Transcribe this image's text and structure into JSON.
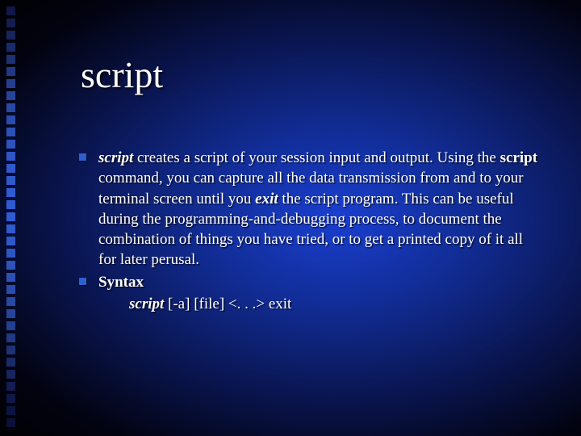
{
  "title": "script",
  "bullets": [
    {
      "cmd": "script",
      "t1": " creates a script of your session input and output. Using the ",
      "cmd2": "script",
      "t2": " command, you can capture all the data transmission from and to your terminal screen until you ",
      "exit": "exit",
      "t3": " the script program. This can be useful during the programming-and-debugging process, to document the combination of things you have tried, or to get a printed copy of it all for later perusal."
    },
    {
      "label": "Syntax",
      "cmd": "script",
      "args": " [-a] [file] <. . .> exit"
    }
  ],
  "deco_colors": [
    "#101848",
    "#141c50",
    "#18245c",
    "#1a2a68",
    "#1e3174",
    "#223882",
    "#253f90",
    "#27449a",
    "#2948a4",
    "#2b4cae",
    "#2d50b8",
    "#2e52be",
    "#2f55c4",
    "#3058ca",
    "#3059ce",
    "#305ad2",
    "#305ad4",
    "#305ad2",
    "#3059ce",
    "#3058ca",
    "#2f55c4",
    "#2e52be",
    "#2d50b8",
    "#2b4cae",
    "#2948a4",
    "#27449a",
    "#253f90",
    "#223882",
    "#1e3174",
    "#1a2a68",
    "#18245c",
    "#141c50",
    "#101848",
    "#0c1440",
    "#0a1038"
  ]
}
